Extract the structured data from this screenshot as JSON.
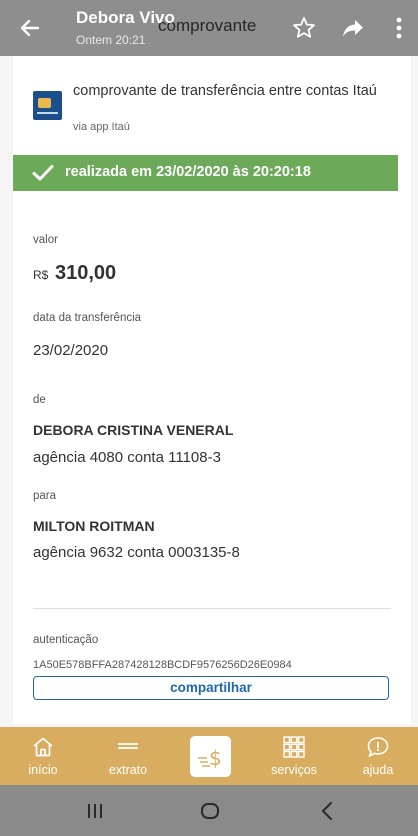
{
  "viewer": {
    "sender_name": "Debora Vivo",
    "sender_time": "Ontem 20:21",
    "title": "comprovante"
  },
  "receipt": {
    "title": "comprovante de transferência entre contas Itaú",
    "subtitle": "via app Itaú",
    "status": "realizada em 23/02/2020 às 20:20:18",
    "valor_label": "valor",
    "currency": "R$",
    "amount": "310,00",
    "date_label": "data da transferência",
    "date": "23/02/2020",
    "from_label": "de",
    "from_name": "DEBORA CRISTINA VENERAL",
    "from_account": "agência 4080 conta 11108-3",
    "to_label": "para",
    "to_name": "MILTON ROITMAN",
    "to_account": "agência 9632 conta 0003135-8",
    "auth_label": "autenticação",
    "auth_code": "1A50E578BFFA287428128BCDF9576256D26E0984",
    "share_button": "compartilhar"
  },
  "nav": {
    "items": [
      {
        "label": "início",
        "icon": "home-icon"
      },
      {
        "label": "extrato",
        "icon": "statement-icon"
      },
      {
        "label": "",
        "icon": "transfer-money-icon"
      },
      {
        "label": "serviços",
        "icon": "services-grid-icon"
      },
      {
        "label": "ajuda",
        "icon": "help-chat-icon"
      }
    ]
  },
  "colors": {
    "status_green": "#6ca959",
    "nav_bar": "#d9ad5f",
    "button_blue": "#1e69a8"
  }
}
